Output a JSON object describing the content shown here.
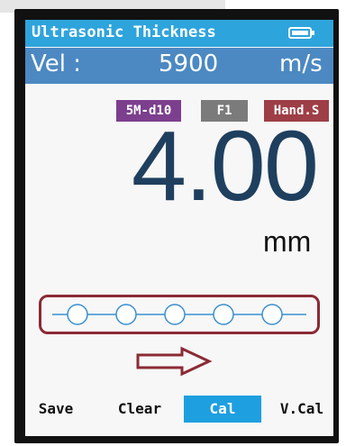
{
  "title": "Ultrasonic Thickness",
  "icons": {
    "battery": "battery-full-icon",
    "arrow": "right-arrow-icon"
  },
  "velocity": {
    "label": "Vel :",
    "value": "5900",
    "unit": "m/s"
  },
  "badges": {
    "probe": "5M-d10",
    "filter": "F1",
    "mode": "Hand.S"
  },
  "reading": {
    "value": "4.00",
    "unit": "mm"
  },
  "coupling_indicator": {
    "circle_count": 5
  },
  "softkeys": [
    "Save",
    "Clear",
    "Cal",
    "V.Cal"
  ],
  "colors": {
    "title_bar": "#2ea4dc",
    "velocity_bar": "#4c89c2",
    "probe_badge": "#7c3f8e",
    "filter_badge": "#7b7b7b",
    "mode_badge": "#9e3e46",
    "reading": "#1f3f5f",
    "highlight": "#8b2a35",
    "active_softkey": "#1e9fe0"
  }
}
